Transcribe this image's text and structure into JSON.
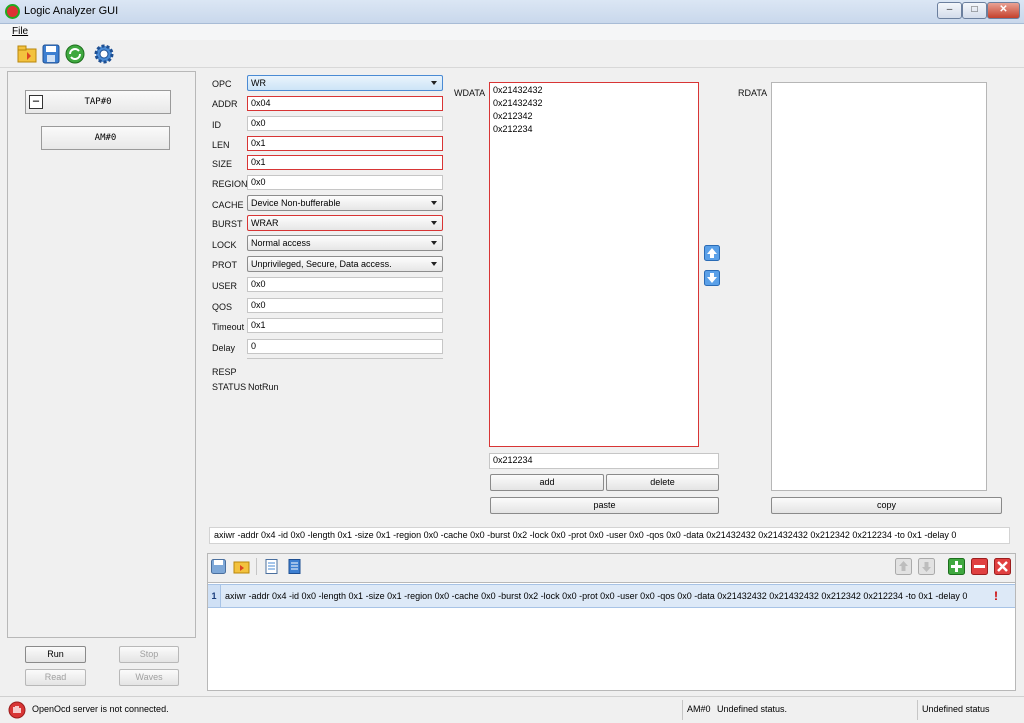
{
  "window": {
    "title": "Logic Analyzer GUI",
    "min": "–",
    "max": "□",
    "close": "✕"
  },
  "menu": {
    "file": "File"
  },
  "toolbar_icons": [
    "open-folder-icon",
    "save-icon",
    "refresh-icon",
    "settings-icon"
  ],
  "tree": {
    "tap": "TAP#0",
    "am": "AM#0",
    "collapse": "−"
  },
  "left_buttons": {
    "run": "Run",
    "stop": "Stop",
    "read": "Read",
    "waves": "Waves"
  },
  "form": {
    "opc": {
      "label": "OPC",
      "value": "WR"
    },
    "addr": {
      "label": "ADDR",
      "value": "0x04"
    },
    "id": {
      "label": "ID",
      "value": "0x0"
    },
    "len": {
      "label": "LEN",
      "value": "0x1"
    },
    "size": {
      "label": "SIZE",
      "value": "0x1"
    },
    "region": {
      "label": "REGION",
      "value": "0x0"
    },
    "cache": {
      "label": "CACHE",
      "value": "Device Non-bufferable"
    },
    "burst": {
      "label": "BURST",
      "value": "WRAR"
    },
    "lock": {
      "label": "LOCK",
      "value": "Normal access"
    },
    "prot": {
      "label": "PROT",
      "value": "Unprivileged, Secure, Data access."
    },
    "user": {
      "label": "USER",
      "value": "0x0"
    },
    "qos": {
      "label": "QOS",
      "value": "0x0"
    },
    "timeout": {
      "label": "Timeout",
      "value": "0x1"
    },
    "delay": {
      "label": "Delay",
      "value": "0"
    },
    "resp": {
      "label": "RESP",
      "value": ""
    },
    "status": {
      "label": "STATUS",
      "value": "NotRun"
    }
  },
  "wdata": {
    "label": "WDATA",
    "items": [
      "0x21432432",
      "0x21432432",
      "0x212342",
      "0x212234"
    ],
    "entry": "0x212234",
    "add": "add",
    "delete": "delete",
    "paste": "paste"
  },
  "rdata": {
    "label": "RDATA",
    "copy": "copy"
  },
  "command": "axiwr -addr 0x4 -id 0x0 -length 0x1 -size 0x1 -region 0x0 -cache 0x0 -burst 0x2 -lock 0x0 -prot 0x0 -user 0x0 -qos 0x0 -data 0x21432432 0x21432432 0x212342 0x212234 -to 0x1 -delay 0",
  "script": {
    "rows": [
      {
        "num": "1",
        "text": "axiwr -addr 0x4 -id 0x0 -length 0x1 -size 0x1 -region 0x0 -cache 0x0 -burst 0x2 -lock 0x0 -prot 0x0 -user 0x0 -qos 0x0 -data 0x21432432 0x21432432 0x212342 0x212234 -to 0x1 -delay 0",
        "flag": "!"
      }
    ]
  },
  "status": {
    "server": "OpenOcd server is not connected.",
    "am": "AM#0",
    "am_status": "Undefined status.",
    "global": "Undefined status"
  },
  "colors": {
    "error_border": "#d83535",
    "selection": "#dde9f7",
    "accent": "#4a8bd4"
  }
}
